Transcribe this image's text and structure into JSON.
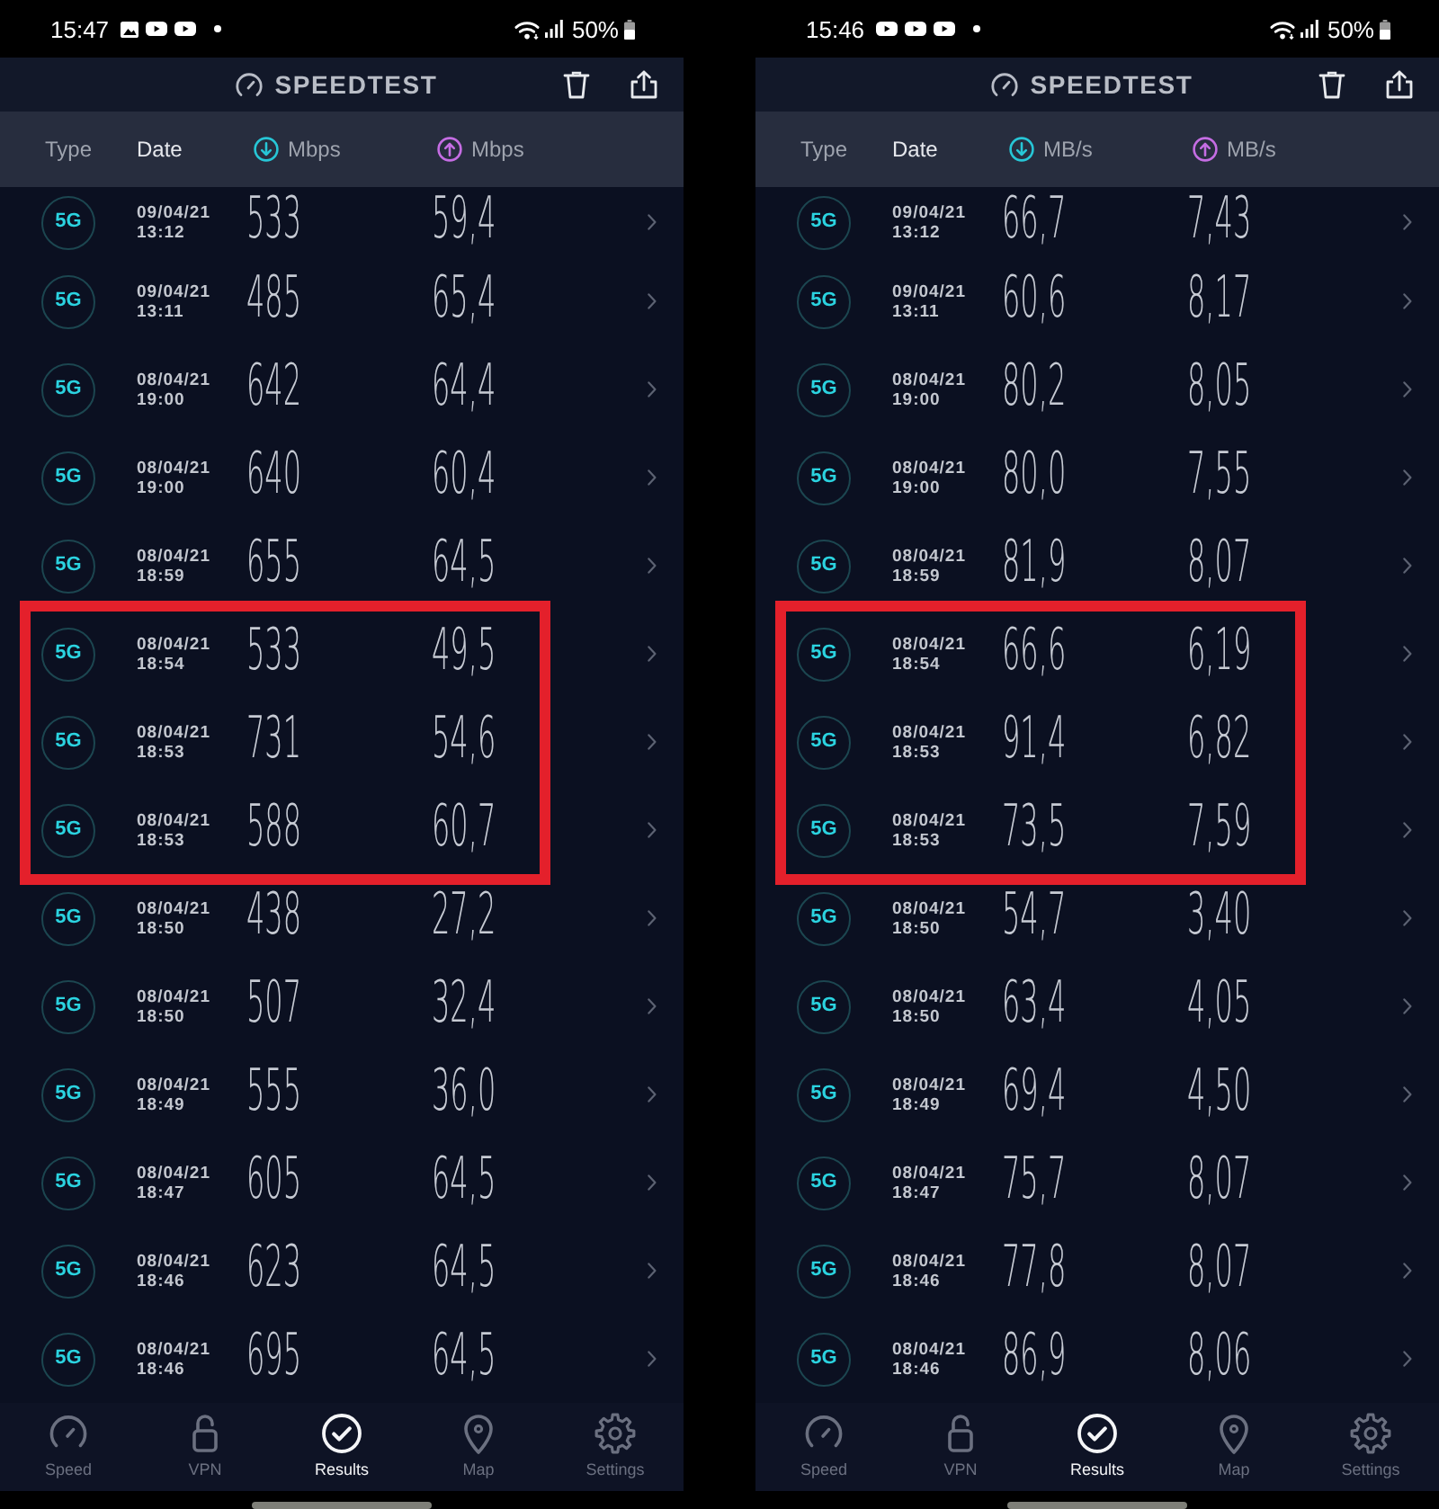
{
  "screens": [
    {
      "status_bar": {
        "time": "15:47",
        "notification_icons": [
          {
            "kind": "image"
          },
          {
            "kind": "video"
          },
          {
            "kind": "video"
          },
          {
            "kind": "dot"
          }
        ],
        "battery": "50%"
      },
      "app_bar": {
        "title": "SPEEDTEST"
      },
      "columns": [
        {
          "label": "Type",
          "kind": "plain",
          "selected": false
        },
        {
          "label": "Date",
          "kind": "plain",
          "selected": true
        },
        {
          "label": "Mbps",
          "kind": "download",
          "selected": false
        },
        {
          "label": "Mbps",
          "kind": "upload",
          "selected": false
        }
      ],
      "rows": [
        {
          "type": "5G",
          "date": "09/04/21",
          "time": "13:12",
          "download": "533",
          "upload": "59,4",
          "highlighted": false
        },
        {
          "type": "5G",
          "date": "09/04/21",
          "time": "13:11",
          "download": "485",
          "upload": "65,4",
          "highlighted": false
        },
        {
          "type": "5G",
          "date": "08/04/21",
          "time": "19:00",
          "download": "642",
          "upload": "64,4",
          "highlighted": false
        },
        {
          "type": "5G",
          "date": "08/04/21",
          "time": "19:00",
          "download": "640",
          "upload": "60,4",
          "highlighted": false
        },
        {
          "type": "5G",
          "date": "08/04/21",
          "time": "18:59",
          "download": "655",
          "upload": "64,5",
          "highlighted": false
        },
        {
          "type": "5G",
          "date": "08/04/21",
          "time": "18:54",
          "download": "533",
          "upload": "49,5",
          "highlighted": true
        },
        {
          "type": "5G",
          "date": "08/04/21",
          "time": "18:53",
          "download": "731",
          "upload": "54,6",
          "highlighted": true
        },
        {
          "type": "5G",
          "date": "08/04/21",
          "time": "18:53",
          "download": "588",
          "upload": "60,7",
          "highlighted": true
        },
        {
          "type": "5G",
          "date": "08/04/21",
          "time": "18:50",
          "download": "438",
          "upload": "27,2",
          "highlighted": false
        },
        {
          "type": "5G",
          "date": "08/04/21",
          "time": "18:50",
          "download": "507",
          "upload": "32,4",
          "highlighted": false
        },
        {
          "type": "5G",
          "date": "08/04/21",
          "time": "18:49",
          "download": "555",
          "upload": "36,0",
          "highlighted": false
        },
        {
          "type": "5G",
          "date": "08/04/21",
          "time": "18:47",
          "download": "605",
          "upload": "64,5",
          "highlighted": false
        },
        {
          "type": "5G",
          "date": "08/04/21",
          "time": "18:46",
          "download": "623",
          "upload": "64,5",
          "highlighted": false
        },
        {
          "type": "5G",
          "date": "08/04/21",
          "time": "18:46",
          "download": "695",
          "upload": "64,5",
          "highlighted": false
        }
      ],
      "nav": [
        {
          "label": "Speed",
          "selected": false
        },
        {
          "label": "VPN",
          "selected": false
        },
        {
          "label": "Results",
          "selected": true
        },
        {
          "label": "Map",
          "selected": false
        },
        {
          "label": "Settings",
          "selected": false
        }
      ]
    },
    {
      "status_bar": {
        "time": "15:46",
        "notification_icons": [
          {
            "kind": "video"
          },
          {
            "kind": "video"
          },
          {
            "kind": "video"
          },
          {
            "kind": "dot"
          }
        ],
        "battery": "50%"
      },
      "app_bar": {
        "title": "SPEEDTEST"
      },
      "columns": [
        {
          "label": "Type",
          "kind": "plain",
          "selected": false
        },
        {
          "label": "Date",
          "kind": "plain",
          "selected": true
        },
        {
          "label": "MB/s",
          "kind": "download",
          "selected": false
        },
        {
          "label": "MB/s",
          "kind": "upload",
          "selected": false
        }
      ],
      "rows": [
        {
          "type": "5G",
          "date": "09/04/21",
          "time": "13:12",
          "download": "66,7",
          "upload": "7,43",
          "highlighted": false
        },
        {
          "type": "5G",
          "date": "09/04/21",
          "time": "13:11",
          "download": "60,6",
          "upload": "8,17",
          "highlighted": false
        },
        {
          "type": "5G",
          "date": "08/04/21",
          "time": "19:00",
          "download": "80,2",
          "upload": "8,05",
          "highlighted": false
        },
        {
          "type": "5G",
          "date": "08/04/21",
          "time": "19:00",
          "download": "80,0",
          "upload": "7,55",
          "highlighted": false
        },
        {
          "type": "5G",
          "date": "08/04/21",
          "time": "18:59",
          "download": "81,9",
          "upload": "8,07",
          "highlighted": false
        },
        {
          "type": "5G",
          "date": "08/04/21",
          "time": "18:54",
          "download": "66,6",
          "upload": "6,19",
          "highlighted": true
        },
        {
          "type": "5G",
          "date": "08/04/21",
          "time": "18:53",
          "download": "91,4",
          "upload": "6,82",
          "highlighted": true
        },
        {
          "type": "5G",
          "date": "08/04/21",
          "time": "18:53",
          "download": "73,5",
          "upload": "7,59",
          "highlighted": true
        },
        {
          "type": "5G",
          "date": "08/04/21",
          "time": "18:50",
          "download": "54,7",
          "upload": "3,40",
          "highlighted": false
        },
        {
          "type": "5G",
          "date": "08/04/21",
          "time": "18:50",
          "download": "63,4",
          "upload": "4,05",
          "highlighted": false
        },
        {
          "type": "5G",
          "date": "08/04/21",
          "time": "18:49",
          "download": "69,4",
          "upload": "4,50",
          "highlighted": false
        },
        {
          "type": "5G",
          "date": "08/04/21",
          "time": "18:47",
          "download": "75,7",
          "upload": "8,07",
          "highlighted": false
        },
        {
          "type": "5G",
          "date": "08/04/21",
          "time": "18:46",
          "download": "77,8",
          "upload": "8,07",
          "highlighted": false
        },
        {
          "type": "5G",
          "date": "08/04/21",
          "time": "18:46",
          "download": "86,9",
          "upload": "8,06",
          "highlighted": false
        }
      ],
      "nav": [
        {
          "label": "Speed",
          "selected": false
        },
        {
          "label": "VPN",
          "selected": false
        },
        {
          "label": "Results",
          "selected": true
        },
        {
          "label": "Map",
          "selected": false
        },
        {
          "label": "Settings",
          "selected": false
        }
      ]
    }
  ]
}
